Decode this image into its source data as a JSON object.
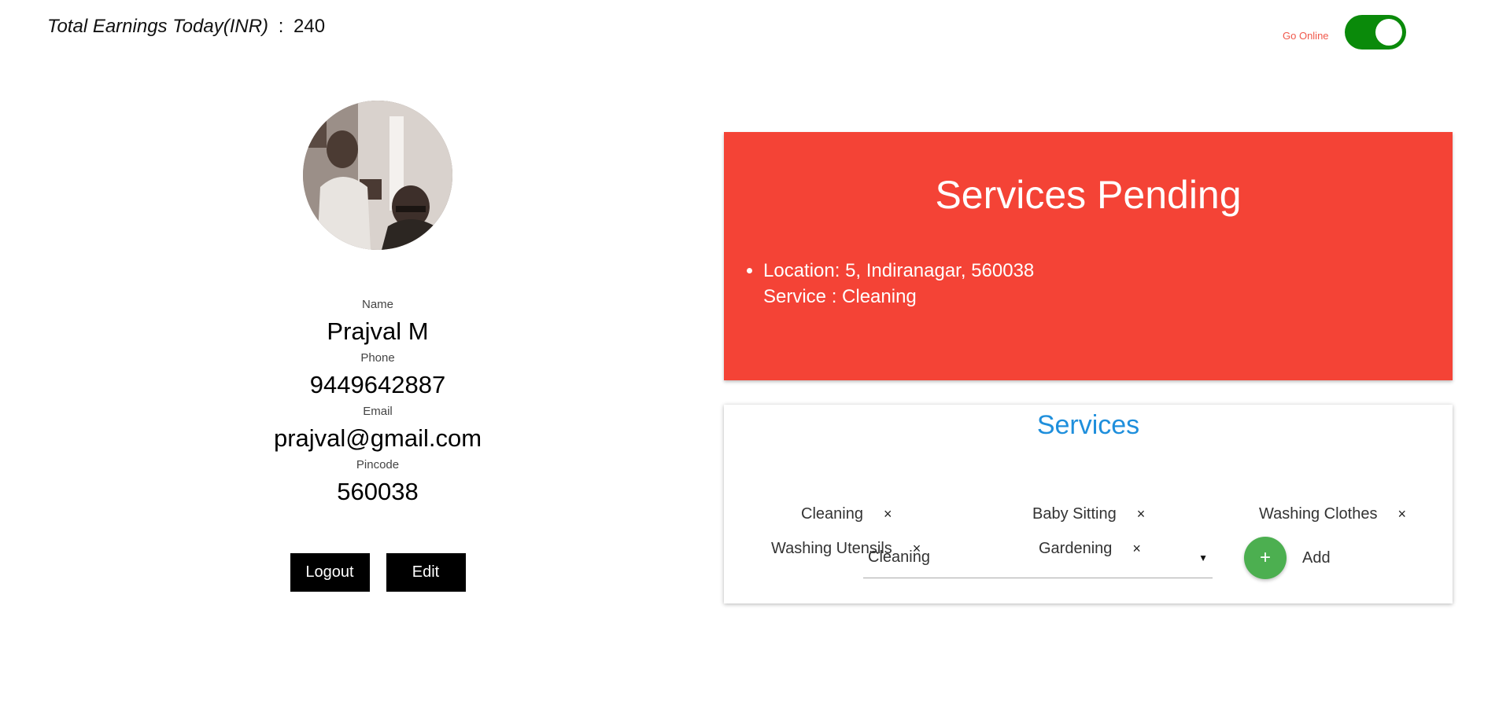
{
  "header": {
    "earnings_label": "Total Earnings Today(INR)",
    "earnings_separator": ":",
    "earnings_value": "240",
    "online_label": "Go Online",
    "online_state": "on",
    "toggle_color": "#0a8a0a"
  },
  "profile": {
    "avatar_icon": "profile-photo",
    "fields": [
      {
        "label": "Name",
        "value": "Prajval M"
      },
      {
        "label": "Phone",
        "value": "9449642887"
      },
      {
        "label": "Email",
        "value": "prajval@gmail.com"
      },
      {
        "label": "Pincode",
        "value": "560038"
      }
    ],
    "logout_label": "Logout",
    "edit_label": "Edit"
  },
  "pending": {
    "title": "Services Pending",
    "color": "#f44336",
    "items": [
      {
        "location": "Location: 5, Indiranagar, 560038",
        "service": "Service : Cleaning"
      }
    ]
  },
  "services": {
    "title": "Services",
    "title_color": "#1f8fdc",
    "chips": [
      "Cleaning",
      "Baby Sitting",
      "Washing Clothes",
      "Washing Utensils",
      "Gardening"
    ],
    "remove_glyph": "×",
    "select_value": "Cleaning",
    "select_caret": "▼",
    "add_glyph": "+",
    "add_label": "Add",
    "add_color": "#4caf50"
  }
}
